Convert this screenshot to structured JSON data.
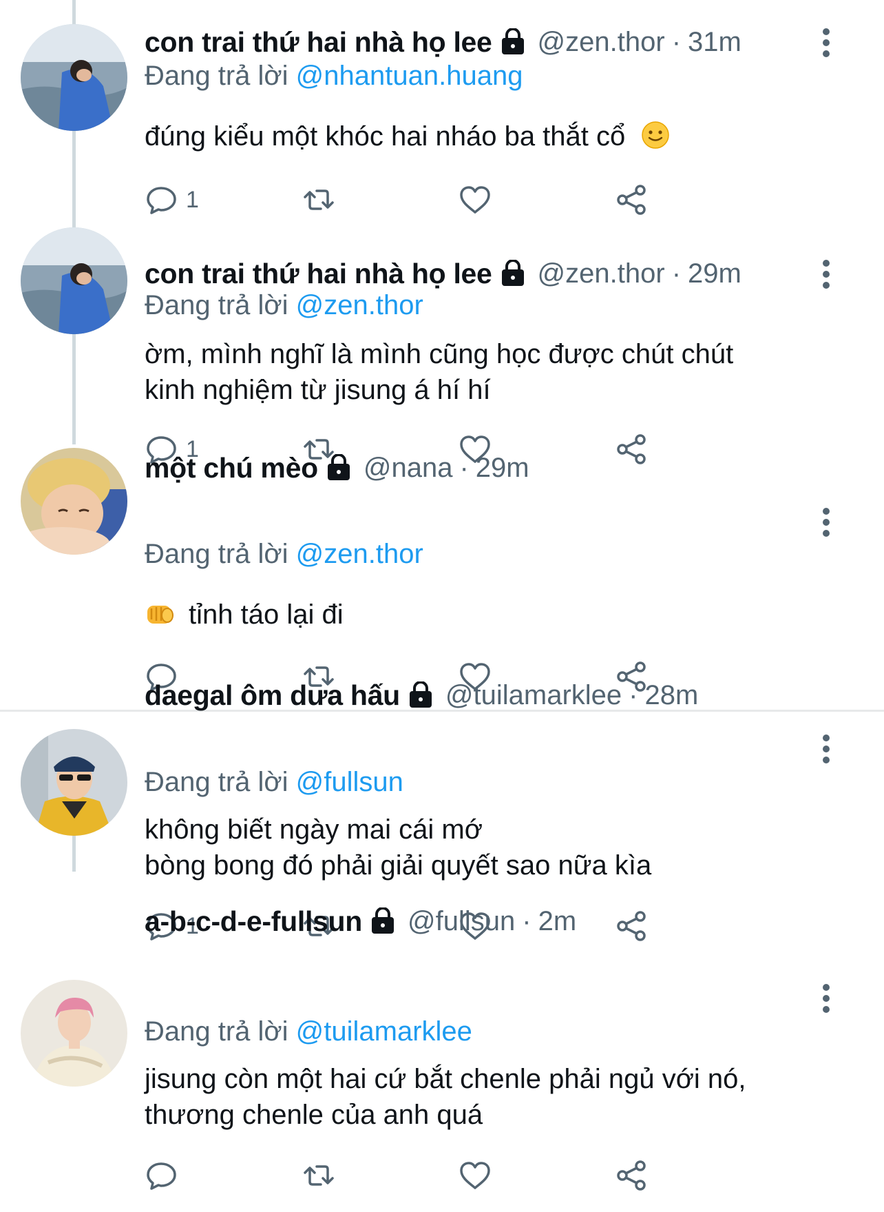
{
  "reply_prefix": "Đang trả lời",
  "tweets": [
    {
      "name": "con trai thứ hai nhà họ lee",
      "handle": "@zen.thor",
      "time": "31m",
      "reply_to": "@nhantuan.huang",
      "lines": [
        "đúng kiểu một khóc hai nháo ba thắt cổ"
      ],
      "reply_count": "1",
      "avatar": "sea-boy-avatar"
    },
    {
      "name": "con trai thứ hai nhà họ lee",
      "handle": "@zen.thor",
      "time": "29m",
      "reply_to": "@zen.thor",
      "lines": [
        "ờm, mình nghĩ là mình cũng học được chút chút",
        "kinh nghiệm từ jisung á hí hí"
      ],
      "reply_count": "1",
      "avatar": "sea-boy-avatar"
    },
    {
      "name": "một chú mèo",
      "handle": "@nana",
      "time": "29m",
      "reply_to": "@zen.thor",
      "lines": [
        "tỉnh táo lại đi"
      ],
      "reply_count": "",
      "avatar": "blond-boy-avatar"
    },
    {
      "name": "daegal ôm dưa hấu",
      "handle": "@tuilamarklee",
      "time": "28m",
      "reply_to": "@fullsun",
      "lines": [
        "không biết ngày mai cái mớ",
        "bòng bong đó phải giải quyết sao nữa kìa"
      ],
      "reply_count": "1",
      "avatar": "bandana-boy-avatar"
    },
    {
      "name": "a-b-c-d-e-fullsun",
      "handle": "@fullsun",
      "time": "2m",
      "reply_to": "@tuilamarklee",
      "lines": [
        "jisung còn một hai cứ bắt chenle phải ngủ với nó,",
        "thương chenle của anh quá"
      ],
      "reply_count": "",
      "avatar": "pink-hair-avatar"
    }
  ],
  "icons": {
    "lock": "lock-icon",
    "more": "more-vertical-icon",
    "reply": "reply-icon",
    "retweet": "retweet-icon",
    "like": "heart-icon",
    "share": "share-icon",
    "smile_emoji": "slightly-smiling-emoji",
    "fist_emoji": "fist-emoji"
  },
  "colors": {
    "mention": "#1d9bf0",
    "secondary_text": "#536471",
    "primary_text": "#0f1419",
    "thread_line": "#cfd9de"
  }
}
